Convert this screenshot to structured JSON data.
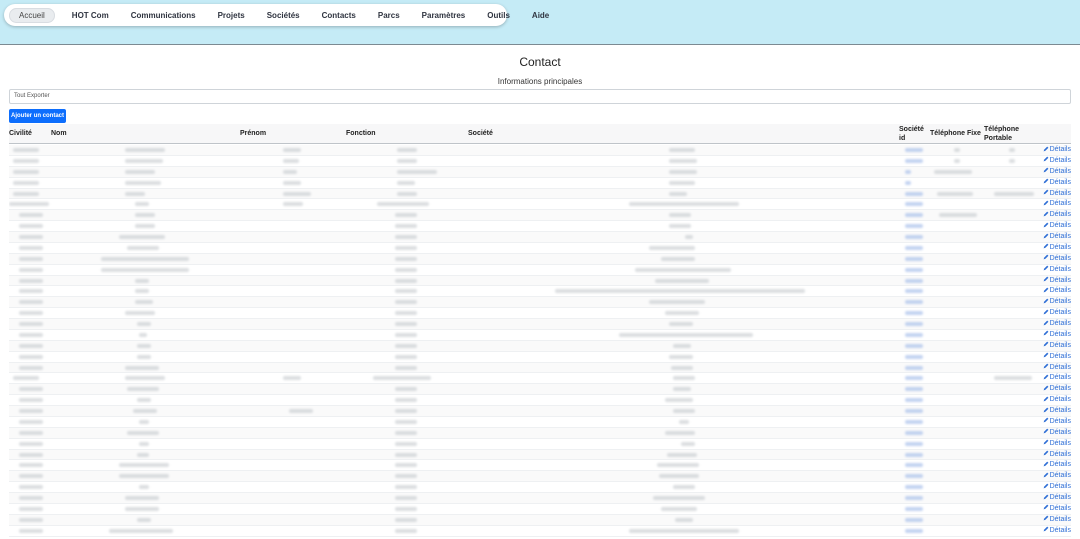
{
  "nav": {
    "items": [
      {
        "label": "Accueil",
        "active": true
      },
      {
        "label": "HOT Com"
      },
      {
        "label": "Communications"
      },
      {
        "label": "Projets"
      },
      {
        "label": "Sociétés"
      },
      {
        "label": "Contacts"
      },
      {
        "label": "Parcs"
      },
      {
        "label": "Paramètres"
      },
      {
        "label": "Outils"
      },
      {
        "label": "Aide"
      }
    ]
  },
  "page": {
    "title": "Contact",
    "section_title": "Informations principales",
    "export_label": "Tout Exporter",
    "add_button_label": "Ajouter un contact"
  },
  "table": {
    "headers": {
      "civilite": "Civilité",
      "nom": "Nom",
      "prenom": "Prénom",
      "fonction": "Fonction",
      "societe": "Société",
      "societe_id": "Société id",
      "tel_fixe": "Téléphone Fixe",
      "tel_portable": "Téléphone Portable"
    },
    "details_label": "Détails"
  },
  "colors": {
    "topbar_bg": "#c5ebf6",
    "primary_button": "#0d6efd",
    "link": "#2f6fd6"
  },
  "icons": {
    "details_icon": "pencil-icon"
  }
}
